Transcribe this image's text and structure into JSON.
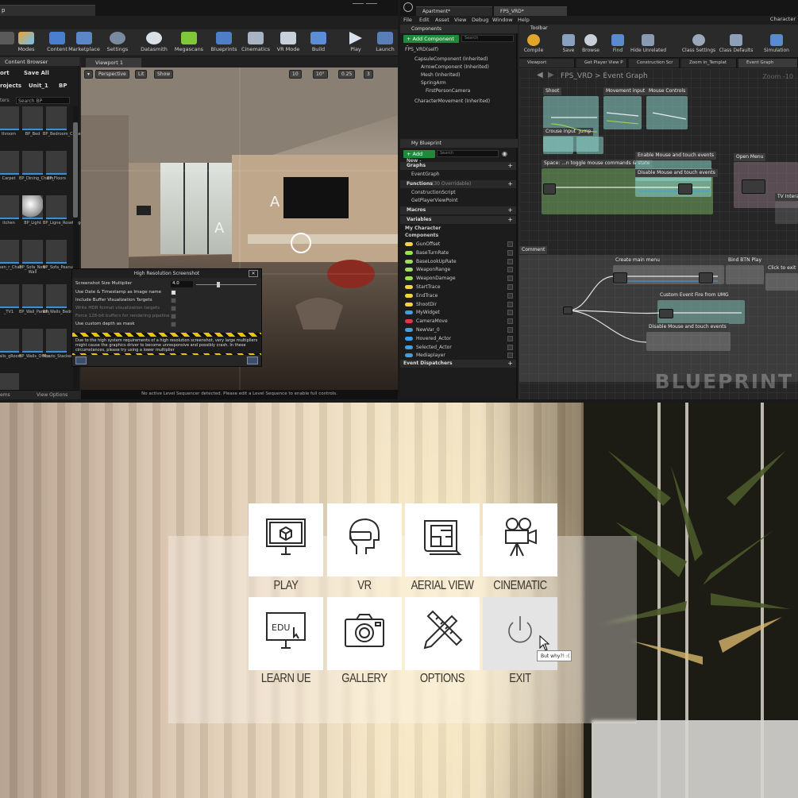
{
  "editor": {
    "title_tab": "p",
    "toolbar": [
      {
        "label": "",
        "icon": "save-icon"
      },
      {
        "label": "Modes",
        "icon": "modes-icon"
      },
      {
        "label": "Content",
        "icon": "content-icon"
      },
      {
        "label": "Marketplace",
        "icon": "marketplace-icon"
      },
      {
        "label": "Settings",
        "icon": "settings-icon"
      },
      {
        "label": "Datasmith",
        "icon": "datasmith-icon"
      },
      {
        "label": "Megascans",
        "icon": "megascans-icon"
      },
      {
        "label": "Blueprints",
        "icon": "blueprints-icon"
      },
      {
        "label": "Cinematics",
        "icon": "cinematics-icon"
      },
      {
        "label": "VR Mode",
        "icon": "vr-mode-icon"
      },
      {
        "label": "Build",
        "icon": "build-icon"
      },
      {
        "label": "Play",
        "icon": "play-icon"
      },
      {
        "label": "Launch",
        "icon": "launch-icon"
      }
    ],
    "content_browser": {
      "tab": "Content Browser",
      "import_label": "ort",
      "save_all": "Save All",
      "path": [
        "rojects",
        "Unit_1",
        "BP"
      ],
      "filters": "ters",
      "search_placeholder": "Search BP",
      "assets": [
        "throom",
        "BP_Bed",
        "BP_Bedroom_Closet",
        "Carpet",
        "BP_Dining_Chairs",
        "BP_Floors",
        "itchen",
        "BP_Light",
        "BP_Ligne_RosetTogo",
        "ufsen_r_Chair",
        "BP_Sofa_New Wall",
        "BP_Sofa_Peanut",
        "_TV1",
        "BP_Wall_Panels",
        "BP_Walls_Bedroom",
        "Walls_gRoom",
        "BP_Walls_Office",
        "Muuto_Stacked_On_Podium_01",
        "Coffe_Cans"
      ],
      "footer_items": "ems",
      "view_options": "View Options"
    },
    "viewport": {
      "tab": "Viewport 1",
      "perspective": "Perspective",
      "lit": "Lit",
      "show": "Show",
      "grid_snap": "10",
      "rot_snap": "10°",
      "scale_snap": "0.25",
      "cam_speed": "3",
      "message": "No active Level Sequencer detected. Please edit a Level Sequence to enable full controls."
    },
    "hires": {
      "title": "High Resolution Screenshot",
      "multiplier_label": "Screenshot Size Multiplier",
      "multiplier_value": "4.0",
      "opt_timestamp": "Use Date & Timestamp as Image name",
      "opt_buffer": "Include Buffer Visualization Targets",
      "opt_hdr": "Write HDR format visualization targets",
      "opt_128": "Force 128-bit buffers for rendering pipeline",
      "opt_depth": "Use custom depth as mask",
      "warning": "Due to the high system requirements of a high resolution screenshot, very large multipliers might cause the graphics driver to become unresponsive and possibly crash. In these circumstances, please try using a lower multiplier"
    }
  },
  "blueprint": {
    "tabs": [
      "Apartment*",
      "FPS_VRD*"
    ],
    "parent_class": "Parent class:",
    "parent_value": "Character",
    "menu": [
      "File",
      "Edit",
      "Asset",
      "View",
      "Debug",
      "Window",
      "Help"
    ],
    "components_header": "Components",
    "add_component": "+ Add Component -",
    "search": "Search",
    "self": "FPS_VRD(self)",
    "components": [
      "CapsuleComponent (Inherited)",
      "ArrowComponent (Inherited)",
      "Mesh (Inherited)",
      "SpringArm",
      "FirstPersonCamera",
      "CharacterMovement (Inherited)"
    ],
    "my_blueprint": "My Blueprint",
    "add_new": "+ Add New -",
    "graphs_header": "Graphs",
    "event_graph": "EventGraph",
    "functions_header": "Functions",
    "functions_count": "(30 Overridable)",
    "functions": [
      "ConstructionScript",
      "GetPlayerViewPoint"
    ],
    "macros_header": "Macros",
    "variables_header": "Variables",
    "my_character": "My Character",
    "components_sub": "Components",
    "variables": [
      {
        "name": "GunOffset",
        "color": "#f5d33a"
      },
      {
        "name": "BaseTurnRate",
        "color": "#9be055"
      },
      {
        "name": "BaseLookUpRate",
        "color": "#9be055"
      },
      {
        "name": "WeaponRange",
        "color": "#9be055"
      },
      {
        "name": "WeaponDamage",
        "color": "#9be055"
      },
      {
        "name": "StartTrace",
        "color": "#f5d33a"
      },
      {
        "name": "EndTrace",
        "color": "#f5d33a"
      },
      {
        "name": "ShootDir",
        "color": "#f5d33a"
      },
      {
        "name": "MyWidget",
        "color": "#3aa0e8"
      },
      {
        "name": "CameraMove",
        "color": "#e8344a"
      },
      {
        "name": "NewVar_0",
        "color": "#3aa0e8"
      },
      {
        "name": "Hovered_Actor",
        "color": "#3aa0e8"
      },
      {
        "name": "Selected_Actor",
        "color": "#3aa0e8"
      },
      {
        "name": "Mediaplayer",
        "color": "#3aa0e8"
      }
    ],
    "event_dispatchers": "Event Dispatchers",
    "toolbar_header": "Toolbar",
    "tools": [
      "Compile",
      "Save",
      "Browse",
      "Find",
      "Hide Unrelated",
      "Class Settings",
      "Class Defaults",
      "Simulation"
    ],
    "graph_tabs": [
      "Viewport",
      "Get Player View P",
      "Construction Scr",
      "Zoom in_Templat",
      "Event Graph"
    ],
    "breadcrumb": "FPS_VRD  >  Event Graph",
    "zoom": "Zoom -10",
    "comments": {
      "shoot": "Shoot",
      "movement": "Movement input",
      "mouse": "Mouse Controls",
      "crouch": "Crouse input",
      "jump": "Jump",
      "space": "Space: ...n toggle mouse commands & state",
      "enable_mouse": "Enable Mouse and touch events",
      "disable_mouse": "Disable Mouse and touch events",
      "open_menu": "Open Menu",
      "tv": "TV Intera",
      "comment": "Comment",
      "create_main": "Create main menu",
      "bind_btn": "Bind BTN Play",
      "click": "Click to exit",
      "custom_event": "Custom Event Fire from UMG",
      "disable_mouse2": "Disable Mouse and touch events"
    },
    "watermark": "BLUEPRINT"
  },
  "menu": {
    "tiles": [
      {
        "label": "PLAY",
        "icon": "monitor-cube-icon"
      },
      {
        "label": "VR",
        "icon": "vr-headset-icon"
      },
      {
        "label": "AERIAL VIEW",
        "icon": "floorplan-icon"
      },
      {
        "label": "CINEMATIC",
        "icon": "movie-camera-icon"
      },
      {
        "label": "LEARN UE",
        "icon": "edu-monitor-icon"
      },
      {
        "label": "GALLERY",
        "icon": "camera-icon"
      },
      {
        "label": "OPTIONS",
        "icon": "pencil-ruler-icon"
      },
      {
        "label": "EXIT",
        "icon": "power-icon"
      }
    ],
    "edu_text": "EDU",
    "tooltip": "But why?! :("
  }
}
